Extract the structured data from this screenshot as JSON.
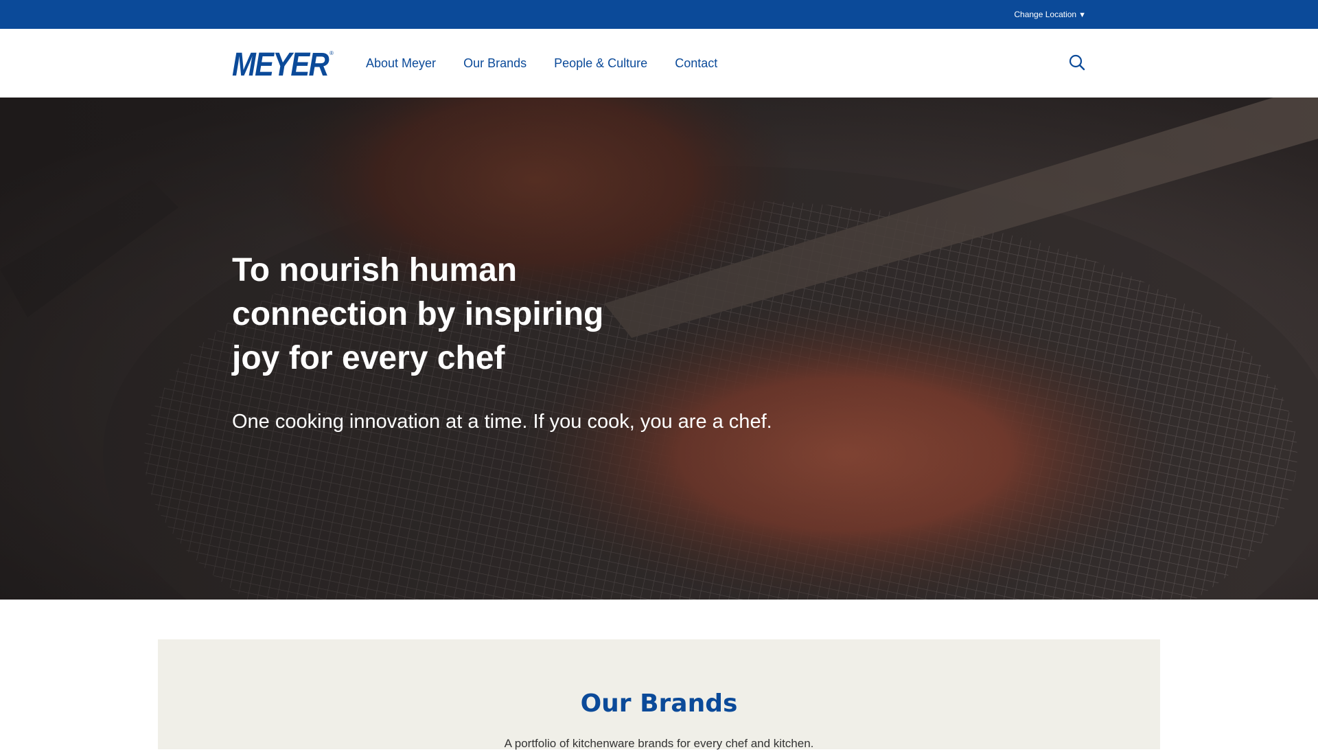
{
  "utility_bar": {
    "change_location_label": "Change Location",
    "caret_icon": "▼"
  },
  "header": {
    "logo_text": "MEYER",
    "logo_mark": "®",
    "nav": [
      {
        "label": "About Meyer"
      },
      {
        "label": "Our Brands"
      },
      {
        "label": "People & Culture"
      },
      {
        "label": "Contact"
      }
    ],
    "search_icon": "search-icon"
  },
  "hero": {
    "title": "To nourish human connection by inspiring joy for every chef",
    "subtitle": "One cooking innovation at a time. If you cook, you are a chef."
  },
  "brands": {
    "heading": "Our Brands",
    "description": "A portfolio of kitchenware brands for every chef and kitchen."
  },
  "colors": {
    "brand_blue": "#0b4a99",
    "section_bg": "#f0efe8"
  }
}
